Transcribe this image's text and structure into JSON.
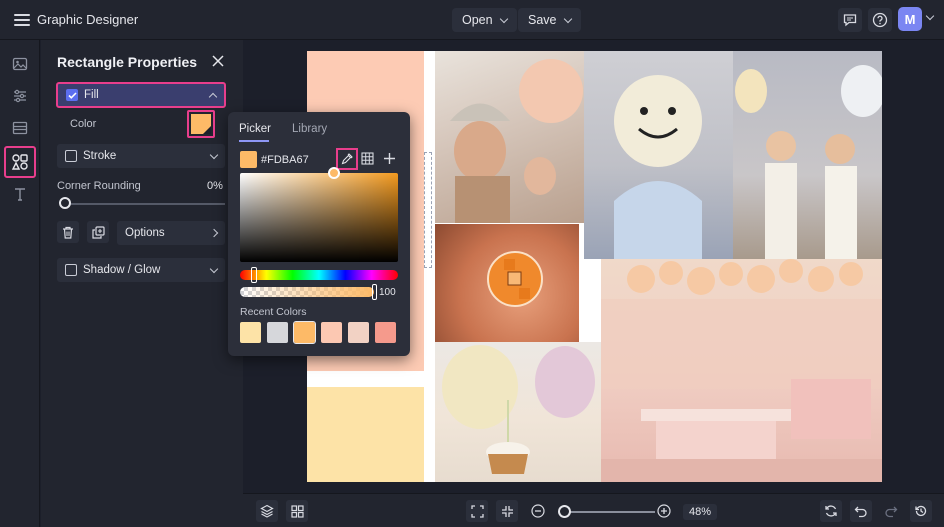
{
  "app": {
    "title": "Graphic Designer"
  },
  "header": {
    "open_label": "Open",
    "save_label": "Save",
    "avatar_initial": "M"
  },
  "panel": {
    "title": "Rectangle Properties",
    "fill_label": "Fill",
    "color_label": "Color",
    "stroke_label": "Stroke",
    "corner_label": "Corner Rounding",
    "corner_value": "0%",
    "options_label": "Options",
    "shadow_label": "Shadow / Glow"
  },
  "picker": {
    "tab_picker": "Picker",
    "tab_library": "Library",
    "hex": "#FDBA67",
    "alpha_value": "100",
    "recent_label": "Recent Colors",
    "recent_colors": [
      "#fde3a7",
      "#d6d7db",
      "#fdba67",
      "#fcc8b2",
      "#f2d2c4",
      "#f59a8c"
    ]
  },
  "zoom": {
    "value": "48%"
  },
  "colors": {
    "accent": "#e83e8c",
    "fill": "#fdba67",
    "peach": "#fdcbb4",
    "cream": "#fde3a7"
  }
}
